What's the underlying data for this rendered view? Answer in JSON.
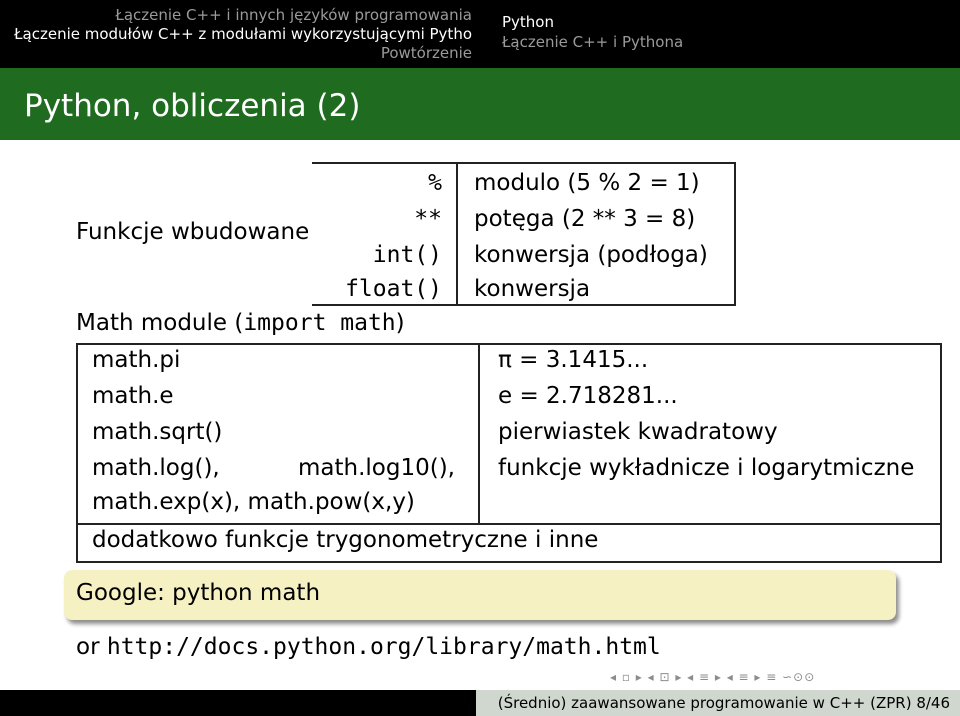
{
  "header": {
    "left_lines": [
      "Łączenie C++ i innych języków programowania",
      "Łączenie modułów C++ z modułami wykorzystującymi Pytho",
      "Powtórzenie"
    ],
    "right_lines": [
      "Python",
      "Łączenie C++ i Pythona"
    ]
  },
  "title": "Python, obliczenia (2)",
  "builtin": {
    "label": "Funkcje wbudowane",
    "rows": [
      {
        "op": "%",
        "desc": "modulo (5 % 2 = 1)"
      },
      {
        "op": "**",
        "desc": "potęga (2 ** 3 = 8)"
      },
      {
        "op": "int()",
        "desc": "konwersja (podłoga)"
      },
      {
        "op": "float()",
        "desc": "konwersja"
      }
    ]
  },
  "math_module": {
    "prefix": "Math module (",
    "code": "import math",
    "suffix": ")"
  },
  "math_table": {
    "rows": [
      {
        "name": "math.pi",
        "desc": "π = 3.1415..."
      },
      {
        "name": "math.e",
        "desc": "e = 2.718281..."
      },
      {
        "name": "math.sqrt()",
        "desc": "pierwiastek kwadratowy"
      },
      {
        "name": "math.log(),",
        "name2": "math.log10(),",
        "desc": "funkcje wykładnicze i logarytmiczne"
      },
      {
        "name": "math.exp(x), math.pow(x,y)"
      }
    ],
    "footer": "dodatkowo funkcje trygonometryczne i inne"
  },
  "google": "Google: python math",
  "or_line": {
    "prefix": "or ",
    "url": "http://docs.python.org/library/math.html"
  },
  "nav_symbols": "◂ ▫ ▸ ◂ ⊡ ▸ ◂ ≡ ▸ ◂ ≡ ▸ ≡ ∽⊙⊙",
  "footer": "(Średnio) zaawansowane programowanie w C++ (ZPR)     8/46",
  "colors": {
    "title_bar": "#1f6b1f",
    "header_bg": "#000000",
    "google_box": "#f5f1c2"
  }
}
